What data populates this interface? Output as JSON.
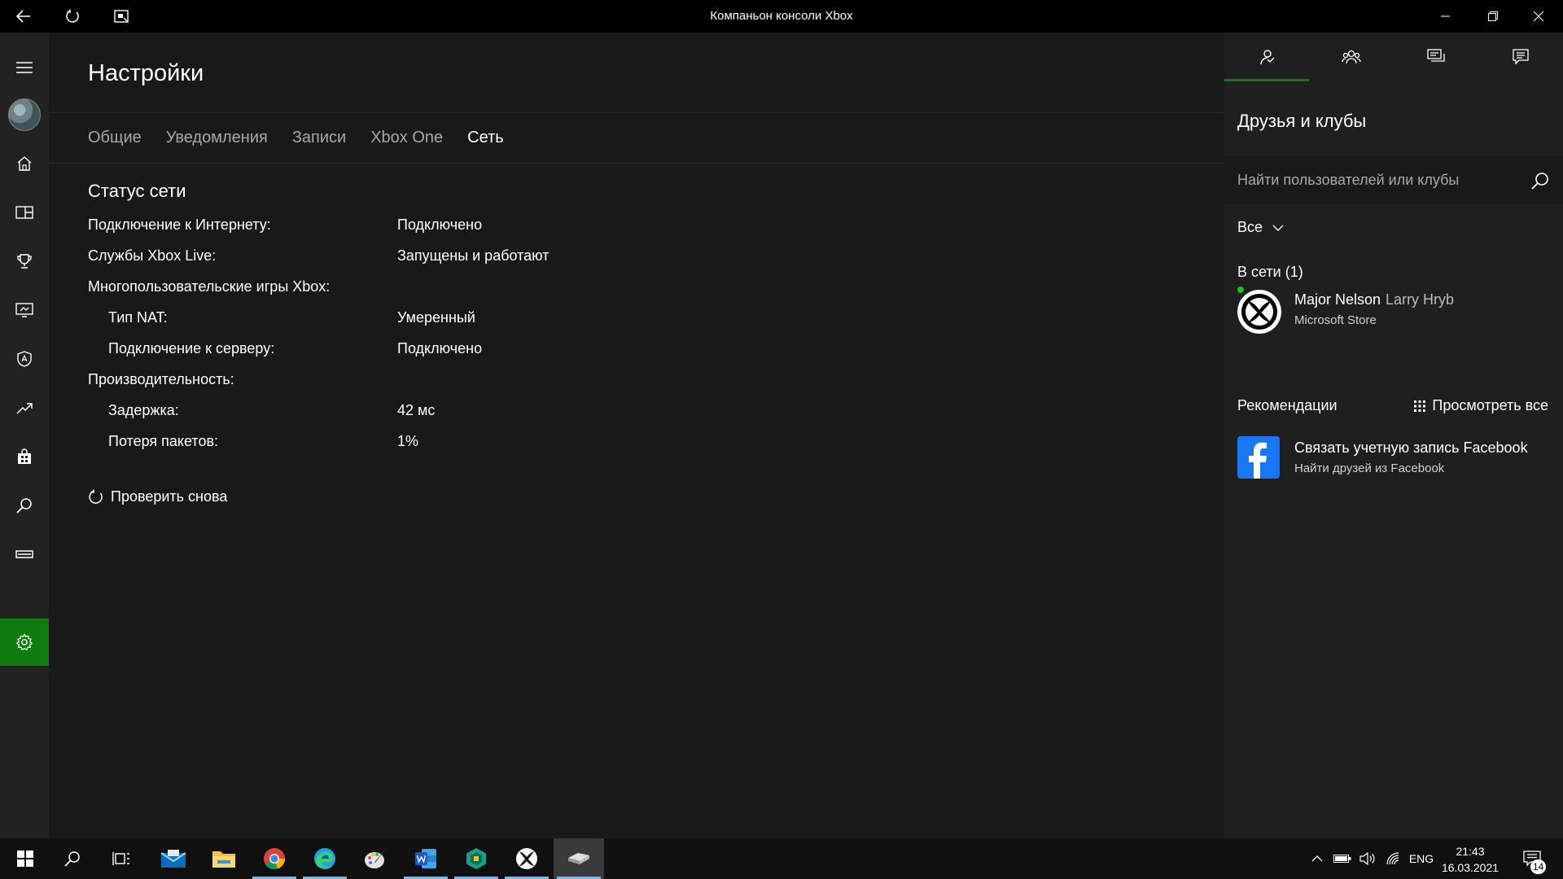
{
  "window": {
    "title": "Компаньон консоли Xbox"
  },
  "leftnav": {
    "items": [
      {
        "icon": "hamburger-menu-icon"
      },
      {
        "icon": "avatar"
      },
      {
        "icon": "home-icon"
      },
      {
        "icon": "my-games-icon"
      },
      {
        "icon": "achievements-trophy-icon"
      },
      {
        "icon": "game-dvr-icon"
      },
      {
        "icon": "clubs-shield-icon"
      },
      {
        "icon": "trending-icon"
      },
      {
        "icon": "store-bag-icon"
      },
      {
        "icon": "search-icon"
      },
      {
        "icon": "console-icon"
      },
      {
        "icon": "settings-gear-icon",
        "active": true
      }
    ],
    "accent": "#107c10"
  },
  "main": {
    "title": "Настройки",
    "tabs": [
      "Общие",
      "Уведомления",
      "Записи",
      "Xbox One",
      "Сеть"
    ],
    "active_tab": "Сеть",
    "section_title": "Статус сети",
    "rows": [
      {
        "label": "Подключение к Интернету:",
        "value": "Подключено"
      },
      {
        "label": "Службы Xbox Live:",
        "value": "Запущены и работают"
      },
      {
        "label": "Многопользовательские игры Xbox:",
        "value": ""
      },
      {
        "label": "Тип NAT:",
        "value": "Умеренный"
      },
      {
        "label": "Подключение к серверу:",
        "value": "Подключено"
      },
      {
        "label": "Производительность:",
        "value": ""
      },
      {
        "label": "Задержка:",
        "value": "42 мс"
      },
      {
        "label": "Потеря пакетов:",
        "value": "1%"
      }
    ],
    "retry_label": "Проверить снова"
  },
  "right_panel": {
    "tabs": [
      "friends-icon",
      "party-icon",
      "messages-icon",
      "activity-feed-icon"
    ],
    "title": "Друзья и клубы",
    "search_placeholder": "Найти пользователей или клубы",
    "filter_label": "Все",
    "online_header": "В сети (1)",
    "friend": {
      "gamertag": "Major Nelson",
      "real_name": "Larry Hryb",
      "status": "Microsoft Store",
      "online_color": "#16c60c"
    },
    "recommendations_header": "Рекомендации",
    "view_all_label": "Просмотреть все",
    "facebook": {
      "title": "Связать учетную запись Facebook",
      "subtitle": "Найти друзей из Facebook",
      "brand_color": "#1877f2"
    }
  },
  "taskbar": {
    "apps": [
      "start-windows-icon",
      "search-icon",
      "task-view-icon",
      "mail-icon",
      "file-explorer-icon",
      "chrome-icon",
      "edge-icon",
      "paint-icon",
      "word-icon",
      "app-icon",
      "xbox-icon",
      "xbox-console-companion-icon"
    ],
    "language": "ENG",
    "time": "21:43",
    "date": "16.03.2021",
    "notifications": "14"
  }
}
